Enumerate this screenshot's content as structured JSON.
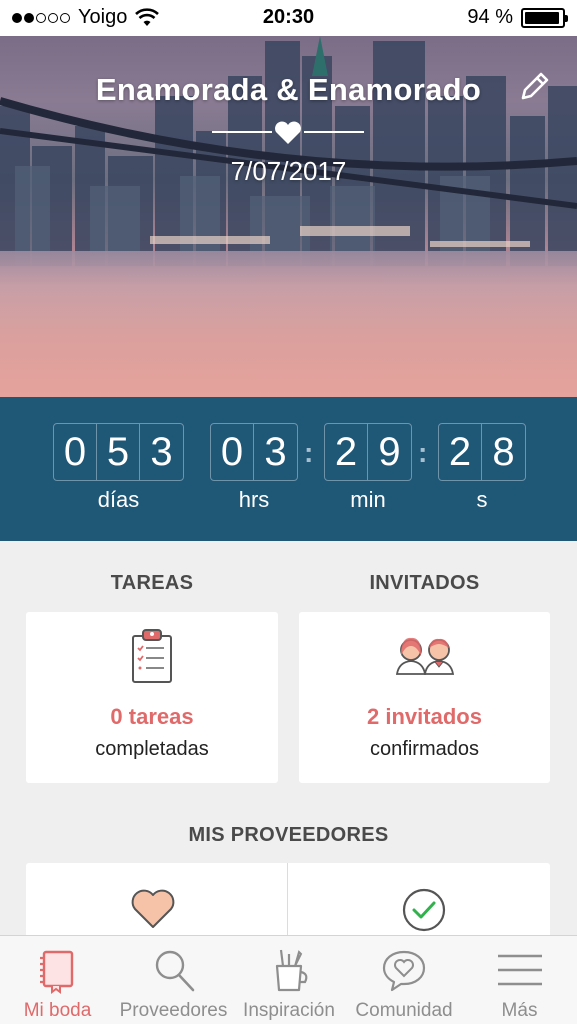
{
  "status_bar": {
    "carrier": "Yoigo",
    "time": "20:30",
    "battery": "94 %",
    "battery_level": 0.94,
    "signal_bars": 2,
    "signal_total": 5
  },
  "hero": {
    "title": "Enamorada & Enamorado",
    "date": "7/07/2017",
    "edit_icon": "pencil-icon"
  },
  "countdown": {
    "days": [
      "0",
      "5",
      "3"
    ],
    "hours": [
      "0",
      "3"
    ],
    "minutes": [
      "2",
      "9"
    ],
    "seconds": [
      "2",
      "8"
    ],
    "labels": {
      "days": "días",
      "hours": "hrs",
      "minutes": "min",
      "seconds": "s"
    }
  },
  "tasks": {
    "section_title": "TAREAS",
    "count_text": "0 tareas",
    "sub_text": "completadas",
    "icon": "clipboard-icon"
  },
  "guests": {
    "section_title": "INVITADOS",
    "count_text": "2 invitados",
    "sub_text": "confirmados",
    "icon": "couple-icon"
  },
  "vendors": {
    "section_title": "MIS PROVEEDORES",
    "left_icon": "heart-icon",
    "right_icon": "check-circle-icon"
  },
  "tabs": [
    {
      "label": "Mi boda",
      "icon": "notebook-icon",
      "active": true
    },
    {
      "label": "Proveedores",
      "icon": "search-icon",
      "active": false
    },
    {
      "label": "Inspiración",
      "icon": "pencil-cup-icon",
      "active": false
    },
    {
      "label": "Comunidad",
      "icon": "chat-heart-icon",
      "active": false
    },
    {
      "label": "Más",
      "icon": "menu-icon",
      "active": false
    }
  ],
  "colors": {
    "accent": "#e0696a",
    "countdown_bg": "#1f5777",
    "page_bg": "#efefef",
    "check_green": "#2fb24b",
    "heart_fill": "#f6c3a9"
  }
}
